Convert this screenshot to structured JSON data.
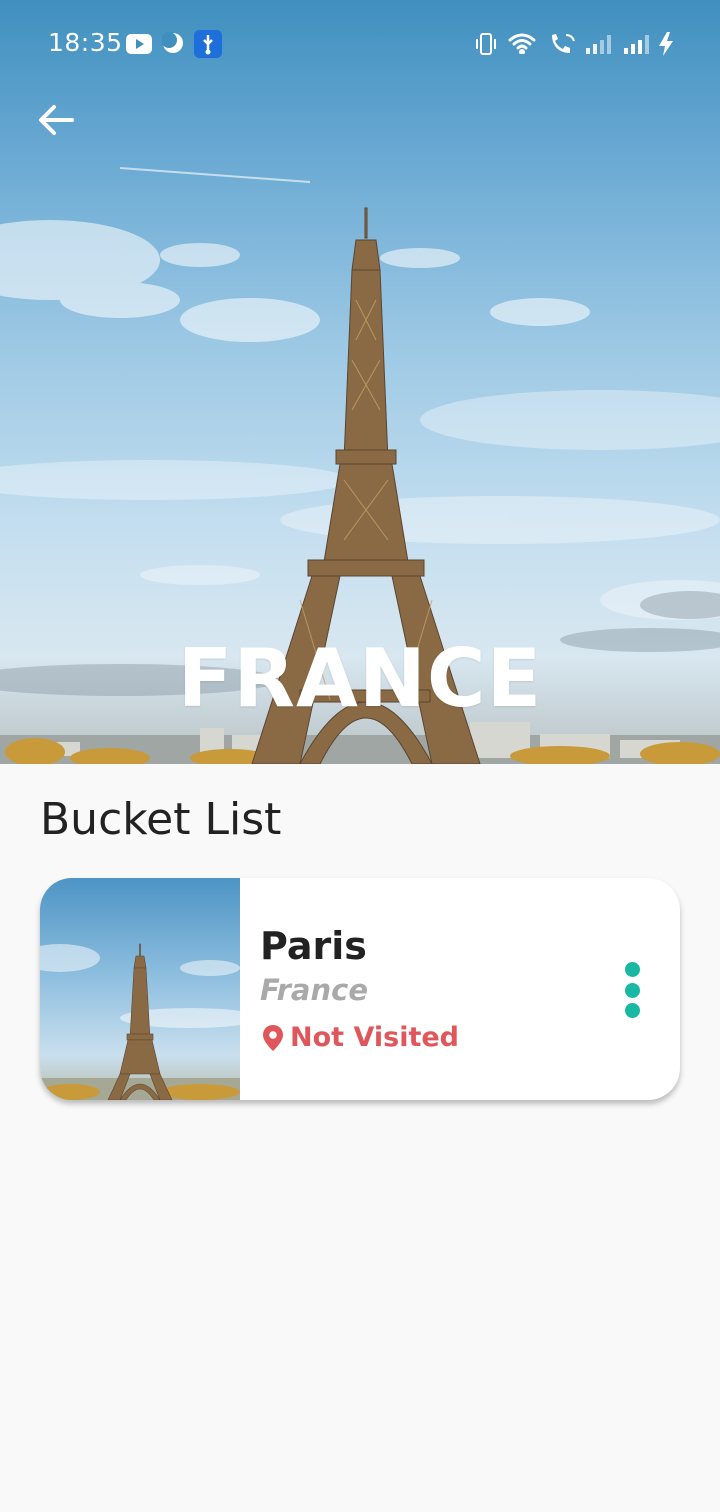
{
  "status_bar": {
    "time": "18:35",
    "icons": [
      "youtube-icon",
      "moon-icon",
      "usb-icon",
      "vibrate-icon",
      "wifi-icon",
      "wifi-calling-icon",
      "signal-1-icon",
      "signal-2-icon",
      "charging-icon"
    ]
  },
  "header": {
    "back_icon": "arrow-left-icon",
    "title": "FRANCE"
  },
  "main": {
    "section_title": "Bucket List",
    "items": [
      {
        "name": "Paris",
        "country": "France",
        "status": "Not Visited",
        "status_icon": "location-pin-icon",
        "menu_icon": "more-vertical-icon"
      }
    ]
  },
  "colors": {
    "accent": "#19b8a2",
    "status_not_visited": "#e0575b",
    "background": "#f9f9f9",
    "text_primary": "#222222",
    "text_secondary": "#a9a9a9"
  }
}
